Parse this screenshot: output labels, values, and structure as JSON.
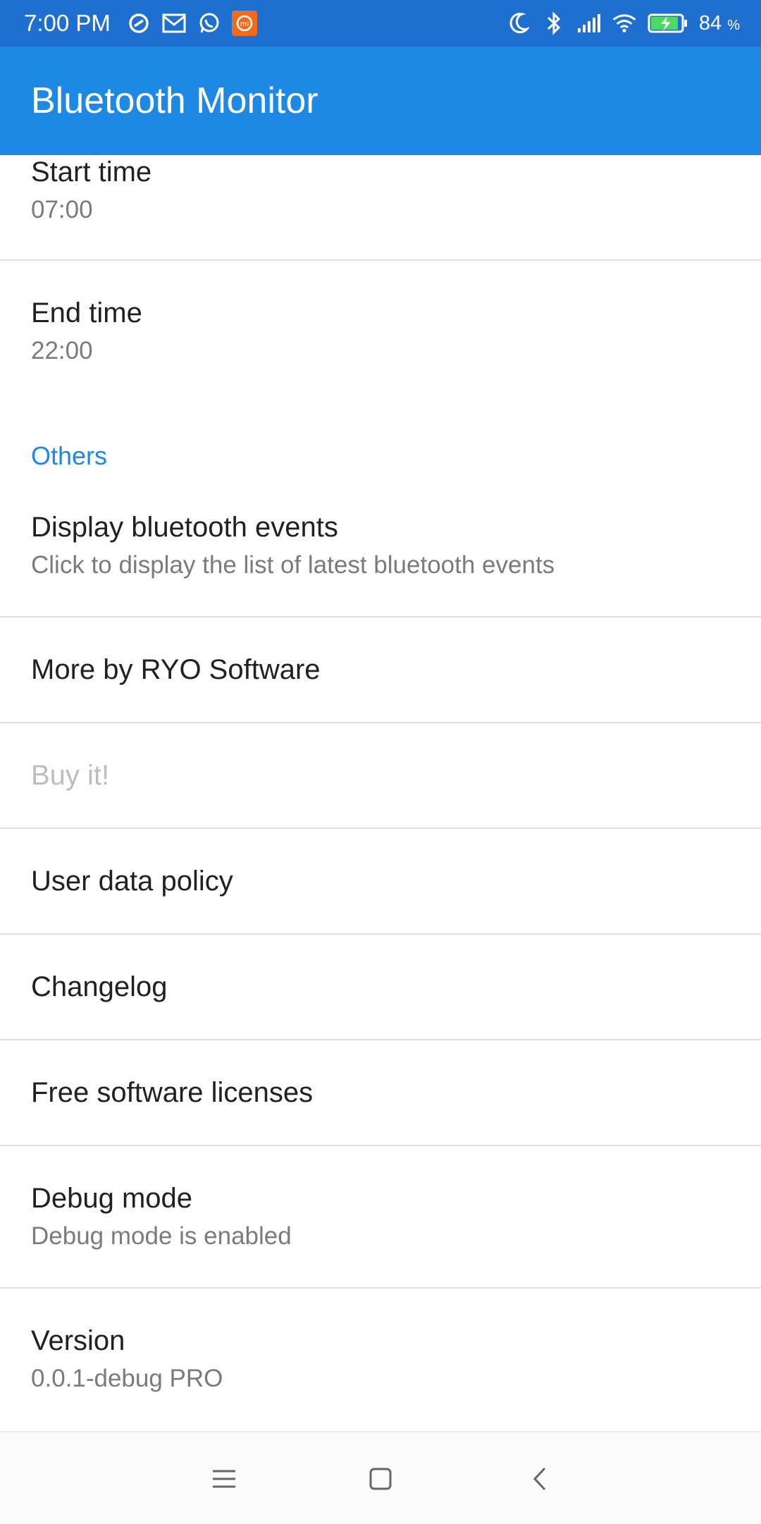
{
  "status_bar": {
    "time": "7:00 PM",
    "battery_percent": "84",
    "battery_unit": "%",
    "left_icons": [
      "vpn-icon",
      "gmail-icon",
      "whatsapp-icon",
      "mi-store-icon"
    ],
    "right_icons": [
      "do-not-disturb-moon-icon",
      "bluetooth-icon",
      "signal-icon",
      "wifi-icon",
      "battery-charging-icon"
    ]
  },
  "app_bar": {
    "title": "Bluetooth Monitor",
    "color": "#1e88e5"
  },
  "preferences": {
    "start_time": {
      "title": "Start time",
      "summary": "07:00"
    },
    "end_time": {
      "title": "End time",
      "summary": "22:00"
    },
    "others_category": "Others",
    "display_events": {
      "title": "Display bluetooth events",
      "summary": "Click to display the list of latest bluetooth events"
    },
    "more_by": {
      "title": "More by RYO Software"
    },
    "buy_it": {
      "title": "Buy it!"
    },
    "user_data_policy": {
      "title": "User data policy"
    },
    "changelog": {
      "title": "Changelog"
    },
    "licenses": {
      "title": "Free software licenses"
    },
    "debug_mode": {
      "title": "Debug mode",
      "summary": "Debug mode is enabled"
    },
    "version": {
      "title": "Version",
      "summary": "0.0.1-debug PRO"
    }
  },
  "nav_bar": {
    "icons": [
      "menu-icon",
      "home-icon",
      "back-icon"
    ]
  }
}
